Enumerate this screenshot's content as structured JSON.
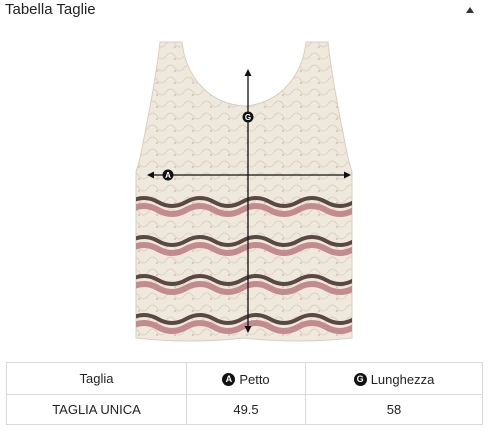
{
  "panel": {
    "title": "Tabella Taglie",
    "toggle_icon": "caret-up-icon"
  },
  "garment": {
    "image_alt": "Top in maglia traforata a righe",
    "colors": {
      "base": "#efe8dc",
      "stripe_pink": "#c48b8e",
      "stripe_brown": "#5a4844"
    },
    "markers": {
      "chest": "A",
      "length": "G"
    }
  },
  "size_table": {
    "headers": {
      "size": "Taglia",
      "chest_marker": "A",
      "chest": "Petto",
      "length_marker": "G",
      "length": "Lunghezza"
    },
    "rows": [
      {
        "size": "TAGLIA UNICA",
        "chest": "49.5",
        "length": "58"
      }
    ]
  }
}
